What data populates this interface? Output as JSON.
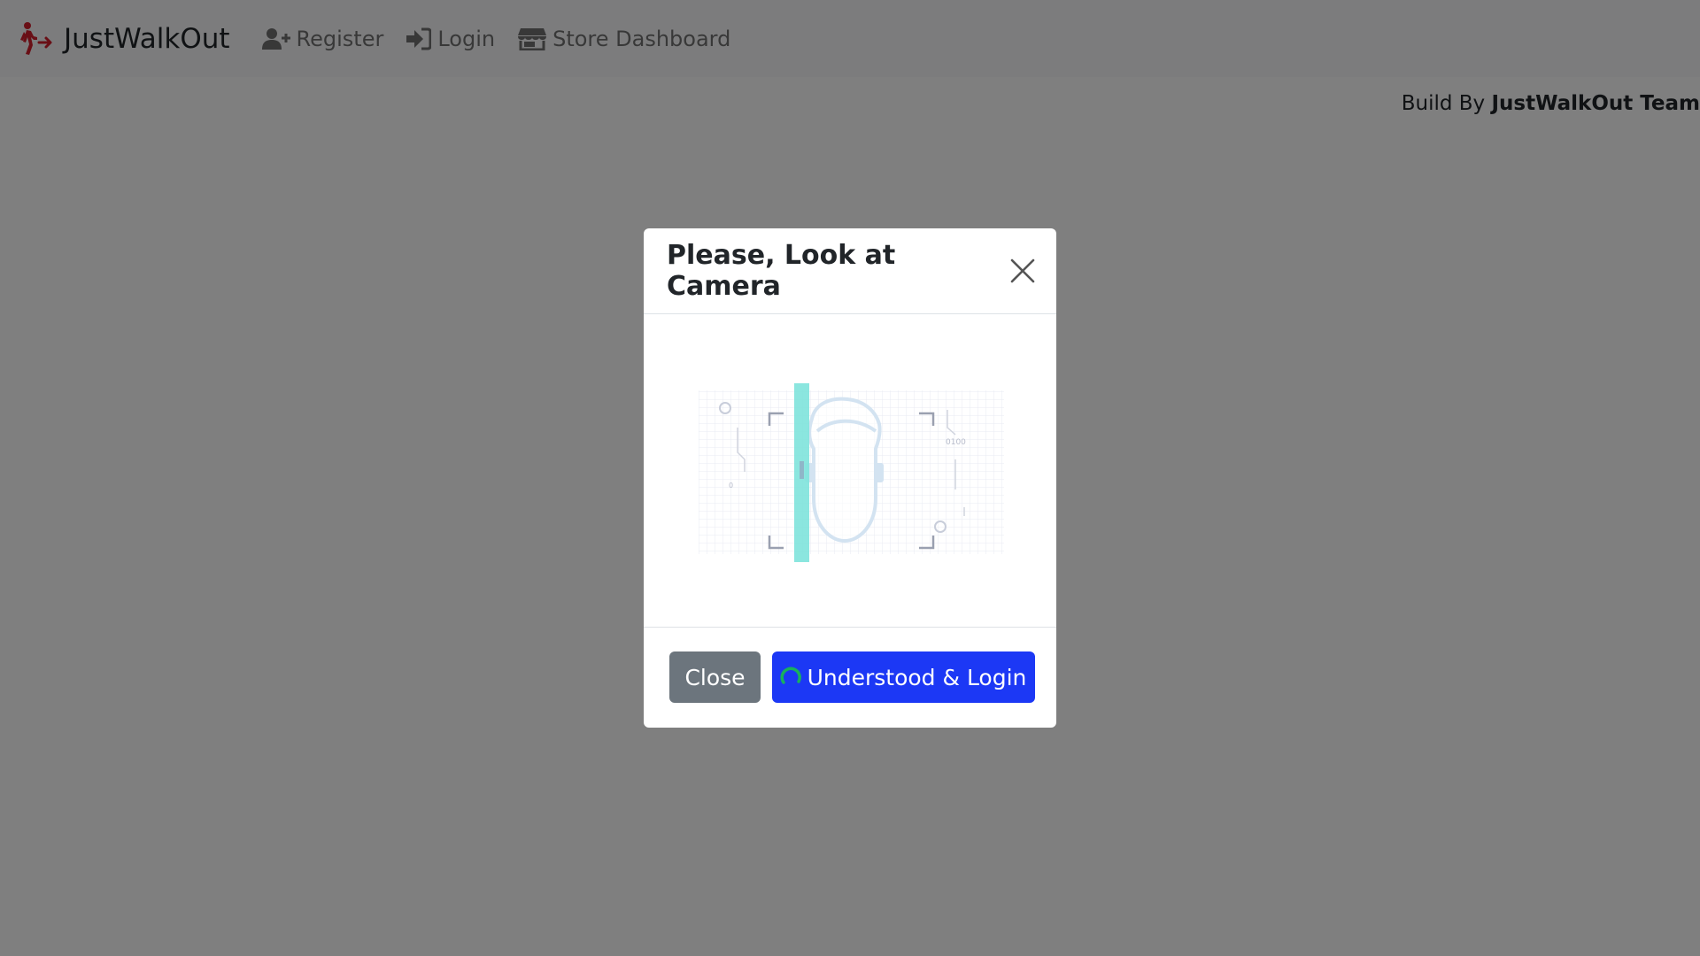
{
  "navbar": {
    "brand": "JustWalkOut",
    "links": [
      {
        "label": "Register",
        "icon": "user-plus-icon"
      },
      {
        "label": "Login",
        "icon": "sign-in-icon"
      },
      {
        "label": "Store Dashboard",
        "icon": "store-icon"
      }
    ]
  },
  "credit": {
    "prefix": "Build By ",
    "team": "JustWalkOut Team"
  },
  "modal": {
    "title": "Please, Look at Camera",
    "illustration_text": {
      "binary": "0100",
      "digit": "0"
    },
    "close_button": "Close",
    "primary_button": "Understood & Login"
  },
  "colors": {
    "primary": "#1c38f5",
    "secondary": "#6c757d",
    "brand_icon": "#d21f2d",
    "scan_bar": "#7ee3db"
  }
}
